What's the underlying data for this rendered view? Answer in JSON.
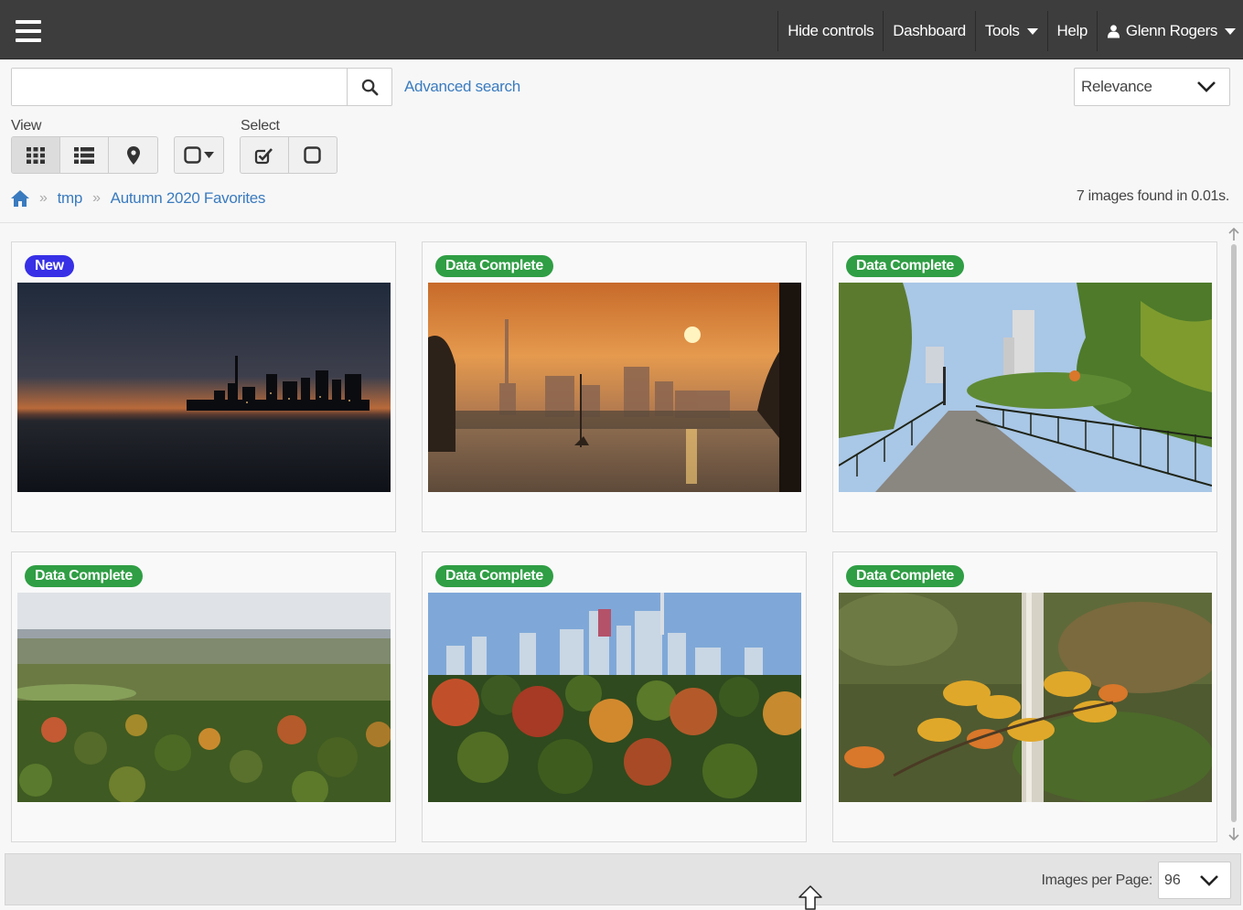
{
  "nav": {
    "hide_controls": "Hide controls",
    "dashboard": "Dashboard",
    "tools": "Tools",
    "help": "Help",
    "user": "Glenn Rogers"
  },
  "search": {
    "value": "",
    "placeholder": "",
    "advanced_label": "Advanced search",
    "sort_selected": "Relevance"
  },
  "view": {
    "label": "View"
  },
  "select": {
    "label": "Select"
  },
  "breadcrumb": {
    "items": [
      "tmp",
      "Autumn 2020 Favorites"
    ]
  },
  "results": {
    "summary": "7 images found in 0.01s."
  },
  "cards": [
    {
      "badge": "New",
      "badge_type": "new",
      "scene": "night-skyline"
    },
    {
      "badge": "Data Complete",
      "badge_type": "complete",
      "scene": "sunset-skyline"
    },
    {
      "badge": "Data Complete",
      "badge_type": "complete",
      "scene": "bridge-park"
    },
    {
      "badge": "Data Complete",
      "badge_type": "complete",
      "scene": "autumn-valley"
    },
    {
      "badge": "Data Complete",
      "badge_type": "complete",
      "scene": "city-autumn"
    },
    {
      "badge": "Data Complete",
      "badge_type": "complete",
      "scene": "yellow-leaves"
    }
  ],
  "footer": {
    "images_per_page_label": "Images per Page:",
    "images_per_page_value": "96"
  },
  "colors": {
    "topbar": "#3d3d3d",
    "link": "#3a7bbf",
    "badge_new": "#3730e6",
    "badge_complete": "#2f9e44"
  }
}
